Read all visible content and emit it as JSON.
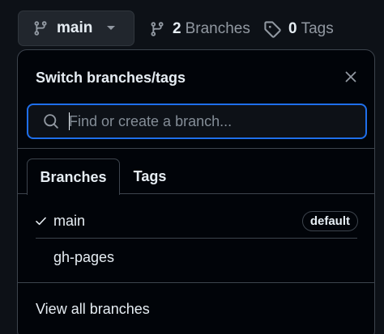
{
  "repo_bar": {
    "branch_button_label": "main",
    "branches_count": "2",
    "branches_label": "Branches",
    "tags_count": "0",
    "tags_label": "Tags"
  },
  "popover": {
    "title": "Switch branches/tags",
    "search_placeholder": "Find or create a branch...",
    "tabs": [
      {
        "label": "Branches",
        "active": true
      },
      {
        "label": "Tags",
        "active": false
      }
    ],
    "branches": [
      {
        "name": "main",
        "selected": true,
        "badge": "default"
      },
      {
        "name": "gh-pages",
        "selected": false,
        "badge": ""
      }
    ],
    "footer_link": "View all branches"
  },
  "colors": {
    "background": "#0d1117",
    "popover_bg": "#010409",
    "accent_focus": "#1f6feb",
    "muted_text": "#9198a1",
    "border": "#3d444d"
  },
  "icons": {
    "branch": "git-branch-icon",
    "caret": "triangle-down-icon",
    "tag": "tag-icon",
    "search": "search-icon",
    "close": "close-icon",
    "check": "check-icon"
  }
}
